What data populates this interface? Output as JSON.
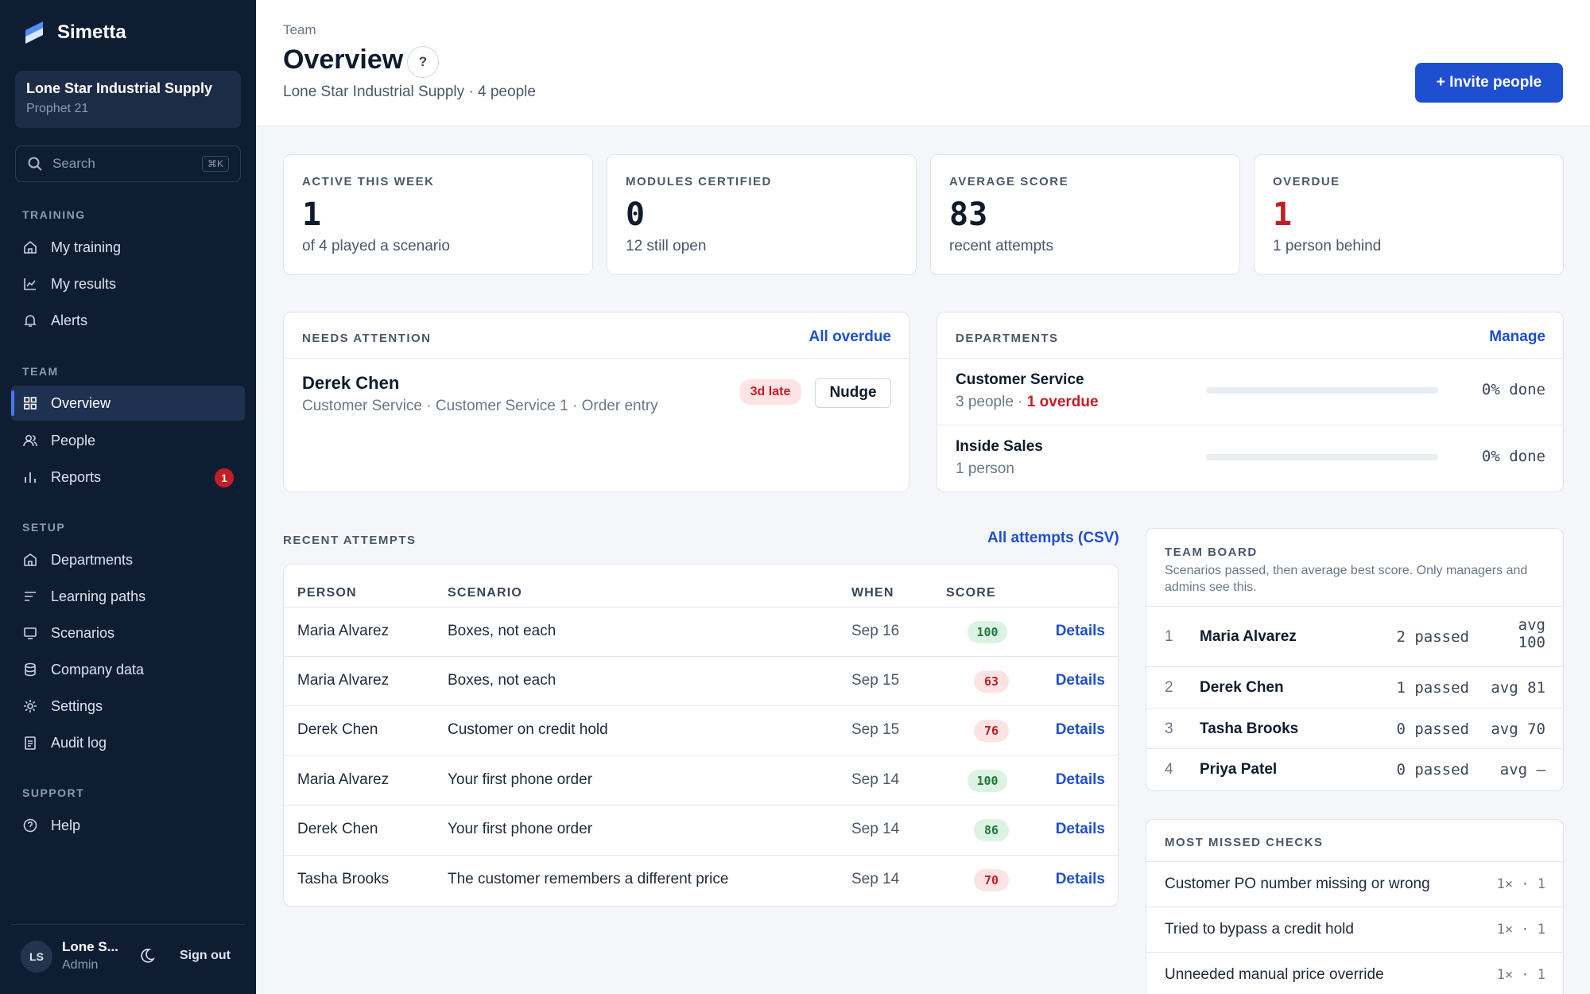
{
  "app": {
    "name": "Simetta"
  },
  "org": {
    "name": "Lone Star Industrial Supply",
    "system": "Prophet 21"
  },
  "search": {
    "placeholder": "Search",
    "shortcut": "⌘K"
  },
  "sidebar": {
    "training": {
      "title": "TRAINING",
      "items": [
        {
          "label": "My training",
          "icon": "home-icon"
        },
        {
          "label": "My results",
          "icon": "chart-line-icon"
        },
        {
          "label": "Alerts",
          "icon": "bell-icon"
        }
      ]
    },
    "team": {
      "title": "TEAM",
      "items": [
        {
          "label": "Overview",
          "icon": "grid-icon",
          "active": true
        },
        {
          "label": "People",
          "icon": "users-icon"
        },
        {
          "label": "Reports",
          "icon": "bar-chart-icon",
          "badge": "1"
        }
      ]
    },
    "setup": {
      "title": "SETUP",
      "items": [
        {
          "label": "Departments",
          "icon": "building-icon"
        },
        {
          "label": "Learning paths",
          "icon": "list-icon"
        },
        {
          "label": "Scenarios",
          "icon": "monitor-icon"
        },
        {
          "label": "Company data",
          "icon": "database-icon"
        },
        {
          "label": "Settings",
          "icon": "gear-icon"
        },
        {
          "label": "Audit log",
          "icon": "clipboard-icon"
        }
      ]
    },
    "support": {
      "title": "SUPPORT",
      "items": [
        {
          "label": "Help",
          "icon": "help-circle-icon"
        }
      ]
    },
    "user": {
      "initials": "LS",
      "name": "Lone S...",
      "role": "Admin",
      "signout": "Sign out"
    }
  },
  "header": {
    "breadcrumb": "Team",
    "title": "Overview",
    "help": "?",
    "subtitle": "Lone Star Industrial Supply · 4 people",
    "invite": "+ Invite people"
  },
  "stats": [
    {
      "label": "ACTIVE THIS WEEK",
      "value": "1",
      "sub": "of 4 played a scenario"
    },
    {
      "label": "MODULES CERTIFIED",
      "value": "0",
      "sub": "12 still open"
    },
    {
      "label": "AVERAGE SCORE",
      "value": "83",
      "sub": "recent attempts"
    },
    {
      "label": "OVERDUE",
      "value": "1",
      "sub": "1 person behind"
    }
  ],
  "attention": {
    "title": "NEEDS ATTENTION",
    "link": "All overdue",
    "item": {
      "name": "Derek Chen",
      "detail": "Customer Service · Customer Service 1 · Order entry",
      "status": "3d late",
      "action": "Nudge"
    }
  },
  "departments": {
    "title": "DEPARTMENTS",
    "link": "Manage",
    "items": [
      {
        "name": "Customer Service",
        "people": "3 people",
        "sep": " · ",
        "overdue": "1 overdue",
        "done": "0% done",
        "progress": 0
      },
      {
        "name": "Inside Sales",
        "people": "1 person",
        "done": "0% done",
        "progress": 0
      }
    ]
  },
  "attempts": {
    "title": "RECENT ATTEMPTS",
    "link": "All attempts (CSV)",
    "columns": [
      "PERSON",
      "SCENARIO",
      "WHEN",
      "SCORE"
    ],
    "rows": [
      {
        "person": "Maria Alvarez",
        "scenario": "Boxes, not each",
        "when": "Sep 16",
        "score": "100",
        "pass": true,
        "action": "Details"
      },
      {
        "person": "Maria Alvarez",
        "scenario": "Boxes, not each",
        "when": "Sep 15",
        "score": "63",
        "pass": false,
        "action": "Details"
      },
      {
        "person": "Derek Chen",
        "scenario": "Customer on credit hold",
        "when": "Sep 15",
        "score": "76",
        "pass": false,
        "action": "Details"
      },
      {
        "person": "Maria Alvarez",
        "scenario": "Your first phone order",
        "when": "Sep 14",
        "score": "100",
        "pass": true,
        "action": "Details"
      },
      {
        "person": "Derek Chen",
        "scenario": "Your first phone order",
        "when": "Sep 14",
        "score": "86",
        "pass": true,
        "action": "Details"
      },
      {
        "person": "Tasha Brooks",
        "scenario": "The customer remembers a different price",
        "when": "Sep 14",
        "score": "70",
        "pass": false,
        "action": "Details"
      }
    ]
  },
  "board": {
    "title": "TEAM BOARD",
    "desc": "Scenarios passed, then average best score. Only managers and admins see this.",
    "rows": [
      {
        "rank": "1",
        "name": "Maria Alvarez",
        "passed": "2 passed",
        "avg1": "avg",
        "avg2": "100"
      },
      {
        "rank": "2",
        "name": "Derek Chen",
        "passed": "1 passed",
        "avg1": "avg 81"
      },
      {
        "rank": "3",
        "name": "Tasha Brooks",
        "passed": "0 passed",
        "avg1": "avg 70"
      },
      {
        "rank": "4",
        "name": "Priya Patel",
        "passed": "0 passed",
        "avg1": "avg —"
      }
    ]
  },
  "missed": {
    "title": "MOST MISSED CHECKS",
    "rows": [
      {
        "label": "Customer PO number missing or wrong",
        "value": "1× · 1"
      },
      {
        "label": "Tried to bypass a credit hold",
        "value": "1× · 1"
      },
      {
        "label": "Unneeded manual price override",
        "value": "1× · 1"
      }
    ]
  },
  "colors": {
    "sidebar": "#0f1d33",
    "accent": "#1e4fd0",
    "danger": "#c41d25",
    "success": "#1d7a3b"
  }
}
